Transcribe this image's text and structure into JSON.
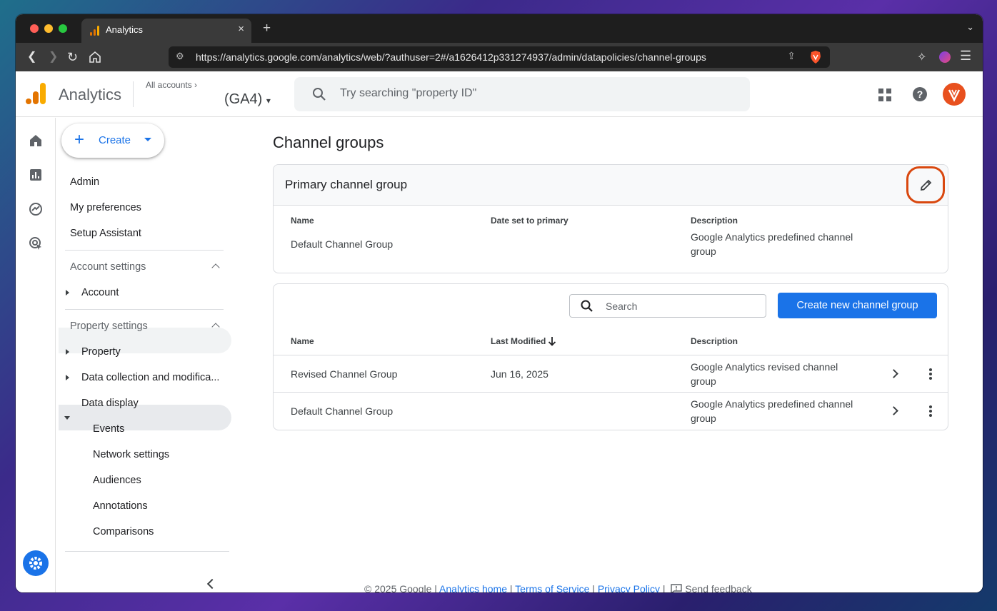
{
  "browser": {
    "tab_title": "Analytics",
    "tab_close": "×",
    "new_tab": "+",
    "url": "https://analytics.google.com/analytics/web/?authuser=2#/a1626412p331274937/admin/datapolicies/channel-groups"
  },
  "header": {
    "brand": "Analytics",
    "all_accounts": "All accounts",
    "property": "(GA4)",
    "search_placeholder": "Try searching \"property ID\"",
    "help": "?"
  },
  "sidebar": {
    "create_label": "Create",
    "items": [
      "Admin",
      "My preferences",
      "Setup Assistant"
    ],
    "account_settings": {
      "label": "Account settings",
      "items": [
        "Account"
      ]
    },
    "property_settings": {
      "label": "Property settings",
      "items": [
        "Property",
        "Data collection and modifica...",
        "Data display"
      ],
      "data_display_children": [
        "Events",
        "Network settings",
        "Audiences",
        "Annotations",
        "Comparisons"
      ]
    }
  },
  "main": {
    "page_title": "Channel groups",
    "primary_card": {
      "title": "Primary channel group",
      "columns": [
        "Name",
        "Date set to primary",
        "Description"
      ],
      "row": {
        "name": "Default Channel Group",
        "date": "",
        "description_line1": "Google Analytics predefined channel",
        "description_line2": "group"
      }
    },
    "table_card": {
      "search_placeholder": "Search",
      "create_button": "Create new channel group",
      "columns": [
        "Name",
        "Last Modified",
        "Description"
      ],
      "rows": [
        {
          "name": "Revised Channel Group",
          "modified": "Jun 16, 2025",
          "description_line1": "Google Analytics revised channel",
          "description_line2": "group"
        },
        {
          "name": "Default Channel Group",
          "modified": "",
          "description_line1": "Google Analytics predefined channel",
          "description_line2": "group"
        }
      ]
    }
  },
  "footer": {
    "copyright": "© 2025 Google |",
    "links": [
      "Analytics home",
      "Terms of Service",
      "Privacy Policy"
    ],
    "sep": "|",
    "feedback": "Send feedback"
  },
  "colors": {
    "accent": "#1a73e8",
    "highlight_ring": "#d9480f",
    "avatar": "#e8501e"
  }
}
